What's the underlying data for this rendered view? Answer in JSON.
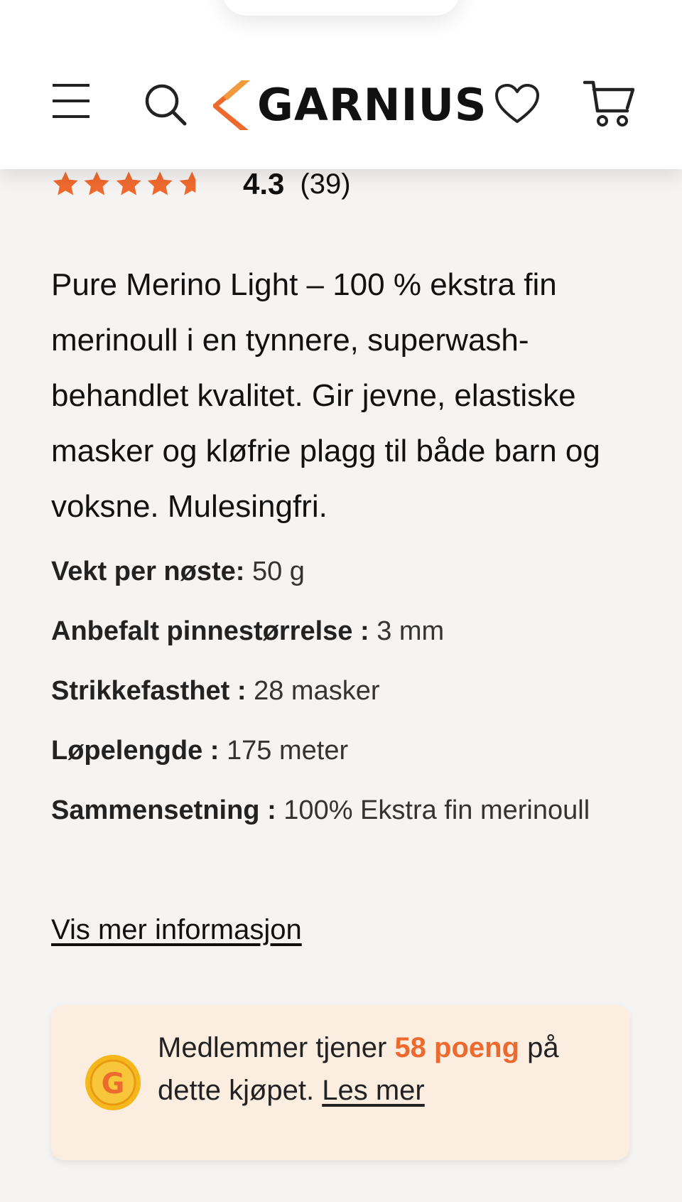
{
  "header": {
    "brand": "GARNIUS",
    "icons": {
      "menu": "hamburger-menu-icon",
      "search": "search-icon",
      "wishlist": "heart-icon",
      "cart": "cart-icon"
    },
    "accent_color": "#ec6a2e"
  },
  "rating": {
    "value": "4.3",
    "count": "(39)",
    "stars_filled": 4.3,
    "stars_max": 5,
    "star_color": "#ef6a2f"
  },
  "product": {
    "description": "Pure Merino Light – 100 % ekstra fin merinoull i en tynnere, superwash-behandlet kvalitet. Gir jevne, elastiske masker og kløfrie plagg til både barn og voksne. Mulesingfri.",
    "specs": [
      {
        "label": "Vekt per nøste:",
        "value": "50 g"
      },
      {
        "label": "Anbefalt pinnestørrelse :",
        "value": "3 mm"
      },
      {
        "label": "Strikkefasthet :",
        "value": "28 masker"
      },
      {
        "label": "Løpelengde :",
        "value": "175 meter"
      },
      {
        "label": "Sammensetning :",
        "value": "100% Ekstra fin merinoull"
      }
    ],
    "more_info_link": "Vis mer informasjon"
  },
  "points_card": {
    "text_before": "Medlemmer tjener ",
    "points": "58 poeng",
    "text_after": " på dette kjøpet. ",
    "link": "Les mer",
    "background": "#fbeee1",
    "coin_icon": "g-coin-icon"
  }
}
